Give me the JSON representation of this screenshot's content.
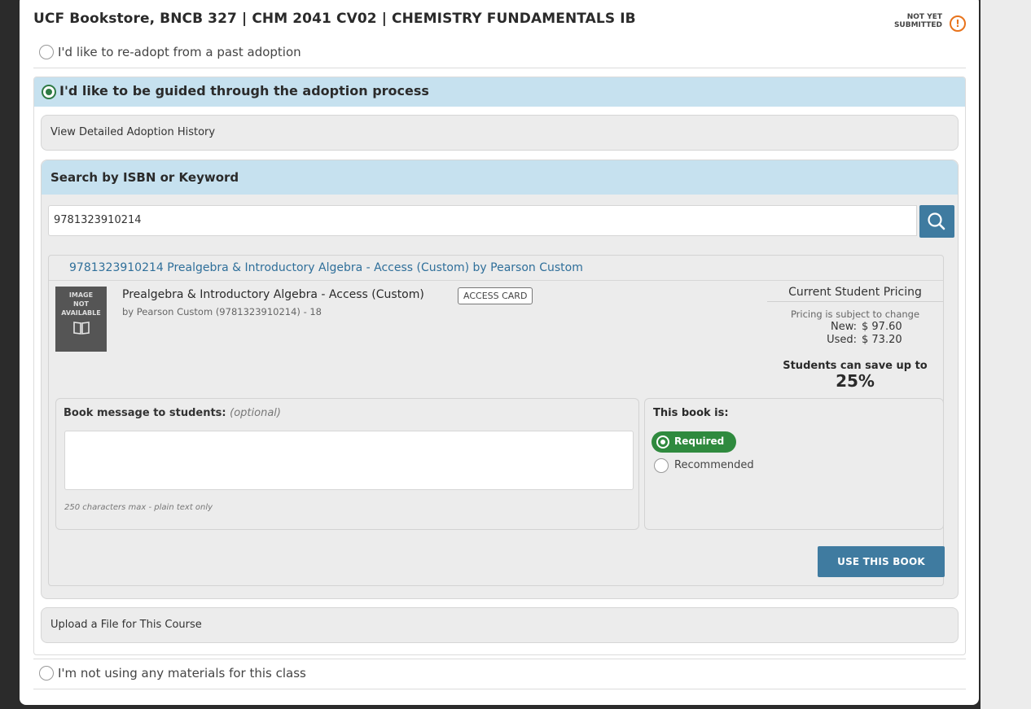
{
  "header": {
    "title": "UCF Bookstore, BNCB 327 | CHM 2041 CV02 | CHEMISTRY FUNDAMENTALS IB",
    "status_line1": "NOT YET",
    "status_line2": "SUBMITTED",
    "status_icon": "!",
    "status_color": "#e8731b"
  },
  "options": {
    "readopt": "I'd like to re-adopt from a past adoption",
    "guided": "I'd like to be guided through the adoption process",
    "none": "I'm not using any materials for this class"
  },
  "guided": {
    "history_label": "View Detailed Adoption History",
    "search_heading": "Search by ISBN or Keyword",
    "search_value": "9781323910214",
    "upload_label": "Upload a File for This Course"
  },
  "result": {
    "link_text": "9781323910214  Prealgebra & Introductory Algebra - Access (Custom) by Pearson Custom",
    "thumb_line1": "IMAGE",
    "thumb_line2": "NOT",
    "thumb_line3": "AVAILABLE",
    "book_title": "Prealgebra & Introductory Algebra - Access (Custom)",
    "badge": "ACCESS CARD",
    "book_by": "by Pearson Custom (9781323910214) - 18",
    "pricing": {
      "title": "Current Student Pricing",
      "note": "Pricing is subject to change",
      "new_label": "New:",
      "new_price": "$ 97.60",
      "used_label": "Used:",
      "used_price": "$ 73.20",
      "save_text": "Students can save up to",
      "save_pct": "25%"
    },
    "message": {
      "label": "Book message to students:",
      "optional": "(optional)",
      "hint": "250 characters max - plain text only"
    },
    "requirement": {
      "label": "This book is:",
      "required": "Required",
      "recommended": "Recommended"
    },
    "use_button": "USE THIS BOOK"
  },
  "colors": {
    "accent_blue": "#3f7ba0",
    "header_blue": "#c6e1ef",
    "required_green": "#2f8a3e"
  }
}
